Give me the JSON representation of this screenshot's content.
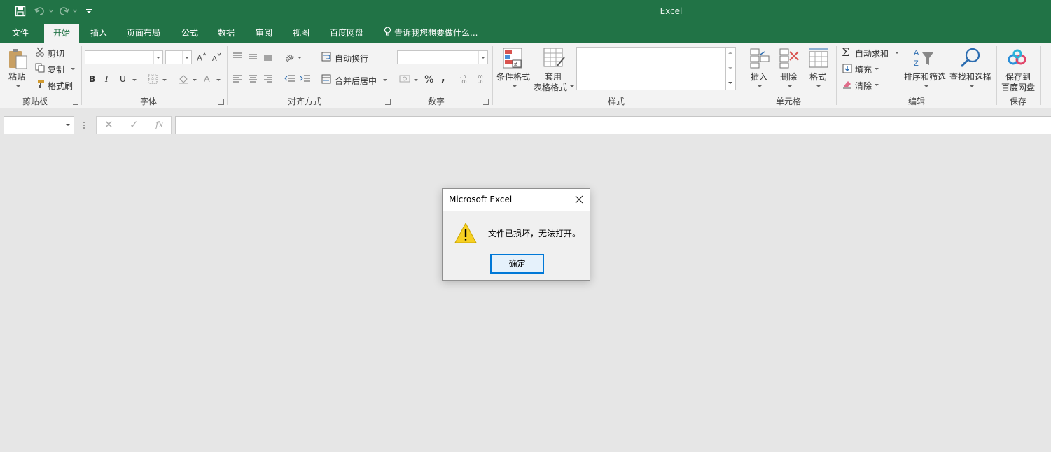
{
  "window": {
    "title": "Excel"
  },
  "quick_access": {
    "save_icon": "save-icon",
    "undo_icon": "undo-icon",
    "redo_icon": "redo-icon",
    "customize_icon": "chevron-down-icon"
  },
  "tabs": [
    {
      "label": "文件"
    },
    {
      "label": "开始"
    },
    {
      "label": "插入"
    },
    {
      "label": "页面布局"
    },
    {
      "label": "公式"
    },
    {
      "label": "数据"
    },
    {
      "label": "审阅"
    },
    {
      "label": "视图"
    },
    {
      "label": "百度网盘"
    }
  ],
  "tell_me": {
    "text": "告诉我您想要做什么..."
  },
  "ribbon": {
    "clipboard": {
      "label": "剪贴板",
      "paste": "粘贴",
      "cut": "剪切",
      "copy": "复制",
      "format_painter": "格式刷"
    },
    "font": {
      "label": "字体",
      "font_name": "",
      "font_size": "",
      "bold": "B",
      "italic": "I",
      "underline": "U"
    },
    "alignment": {
      "label": "对齐方式",
      "wrap_text": "自动换行",
      "merge_center": "合并后居中"
    },
    "number": {
      "label": "数字",
      "format": "",
      "percent": "%",
      "comma": ","
    },
    "styles": {
      "label": "样式",
      "conditional_format": "条件格式",
      "table_format_1": "套用",
      "table_format_2": "表格格式"
    },
    "cells": {
      "label": "单元格",
      "insert": "插入",
      "delete": "删除",
      "format": "格式"
    },
    "editing": {
      "label": "编辑",
      "autosum": "自动求和",
      "fill": "填充",
      "clear": "清除",
      "sort_filter": "排序和筛选",
      "find_select": "查找和选择"
    },
    "save": {
      "label": "保存",
      "save_to_1": "保存到",
      "save_to_2": "百度网盘"
    }
  },
  "formula_bar": {
    "name_box": "",
    "fx": "fx",
    "formula": ""
  },
  "dialog": {
    "title": "Microsoft Excel",
    "message": "文件已损坏，无法打开。",
    "ok": "确定"
  },
  "colors": {
    "accent": "#217346",
    "background": "#e6e6e6",
    "ribbon": "#f3f3f3",
    "dialog_button_border": "#0078d7"
  }
}
